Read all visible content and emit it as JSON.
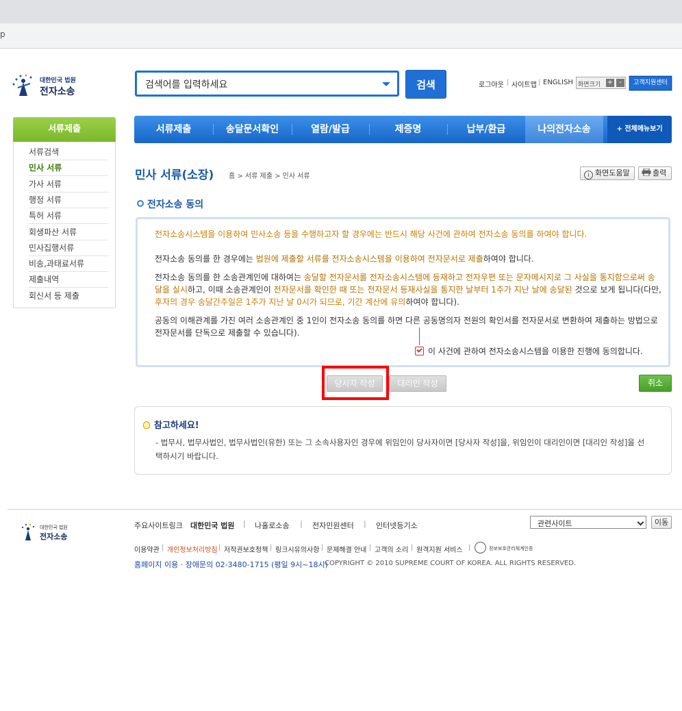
{
  "browser": {
    "address_text": "p"
  },
  "header": {
    "logo_small": "대한민국 법원",
    "logo_big": "전자소송",
    "search_placeholder": "검색어를 입력하세요",
    "search_button": "검색",
    "util_links": [
      "로그아웃",
      "사이트맵",
      "ENGLISH"
    ],
    "font_size_label": "화면크기",
    "font_plus": "+",
    "font_minus": "-",
    "support_button": "고객지원센터"
  },
  "sidebar": {
    "heading": "서류제출",
    "items": [
      {
        "label": "서류검색",
        "active": false
      },
      {
        "label": "민사 서류",
        "active": true
      },
      {
        "label": "가사 서류",
        "active": false
      },
      {
        "label": "행정 서류",
        "active": false
      },
      {
        "label": "특허 서류",
        "active": false
      },
      {
        "label": "회생파산 서류",
        "active": false
      },
      {
        "label": "민사집행서류",
        "active": false
      },
      {
        "label": "비송,과태료서류",
        "active": false
      },
      {
        "label": "제출내역",
        "active": false
      },
      {
        "label": "회신서 등 제출",
        "active": false
      }
    ]
  },
  "nav": {
    "items": [
      "서류제출",
      "송달문서확인",
      "열람/발급",
      "제증명",
      "납부/환급",
      "나의전자소송"
    ],
    "selected": "나의전자소송",
    "all_menu": "+ 전체메뉴보기"
  },
  "page": {
    "title": "민사 서류(소장)",
    "breadcrumb": "홈 > 서류 제출 > 민사 서류",
    "help_button": "화면도움말",
    "print_button": "출력",
    "section_title": "전자소송 동의"
  },
  "consent": {
    "intro": "전자소송시스템을 이용하여 민사소송 등을 수행하고자 할 경우에는 반드시 해당 사건에 관하여 전자소송 동의를 하여야 합니다.",
    "p1_a": "전자소송 동의를 한 경우에는 ",
    "p1_hl": "법원에 제출할 서류를 전자소송시스템을 이용하여 전자문서로 제출",
    "p1_b": "하여야 합니다.",
    "p2_a": "전자소송 동의를 한 소송관계인에 대하여는 ",
    "p2_hl1": "송달할 전자문서를 전자소송시스템에 등재하고 전자우편 또는 문자메시지로 그 사실을 통지함으로써 송달을 실시",
    "p2_b": "하고, 이때 소송관계인이 ",
    "p2_hl2": "전자문서를 확인한 때 또는 전자문서 등재사실을 통지한 날부터 1주가 지난 날에 송달된",
    "p2_c": " 것으로 보게 됩니다(다만, ",
    "p2_hl3": "후자의 경우 송달간주일은 1주가 지난 날 0시가 되므로, 기간 계산에 유의",
    "p2_d": "하여야 합니다).",
    "p3": "공동의 이해관계를 가진 여러 소송관계인 중 1인이 전자소송 동의를 하면 다른 공동명의자 전원의 확인서를 전자문서로 변환하여 제출하는 방법으로 전자문서를 단독으로 제출할 수 있습니다).",
    "agree_label": "이 사건에 관하여 전자소송시스템을 이용한 진행에 동의합니다.",
    "agree_checked": true
  },
  "actions": {
    "party_button": "당사자 작성",
    "agent_button": "대리인 작성",
    "cancel_button": "취소"
  },
  "notice": {
    "title": "참고하세요!",
    "text": "- 법무사, 법무사법인, 법무사법인(유한) 또는 그 소속사용자인 경우에 위임인이 당사자이면 [당사자 작성]을, 위임인이 대리인이면 [대리인 작성]을 선택하시기 바랍니다."
  },
  "footer": {
    "logo_small": "대한민국 법원",
    "logo_big": "전자소송",
    "links": [
      "주요사이트링크",
      "대한민국 법원",
      "나홀로소송",
      "전자민원센터",
      "인터넷등기소"
    ],
    "related_select": "관련사이트",
    "go_button": "이동",
    "small_links": [
      "이용약관",
      "개인정보처리방침",
      "저작권보호정책",
      "링크시유의사항",
      "문제해결 안내",
      "고객의 소리",
      "원격지원 서비스"
    ],
    "cert_text": "정보보호관리체계인증",
    "contact": "홈페이지 이용 · 장애문의 02-3480-1715 (평일 9시~18시)",
    "copyright": "COPYRIGHT © 2010 SUPREME COURT OF KOREA. ALL RIGHTS RESERVED."
  }
}
